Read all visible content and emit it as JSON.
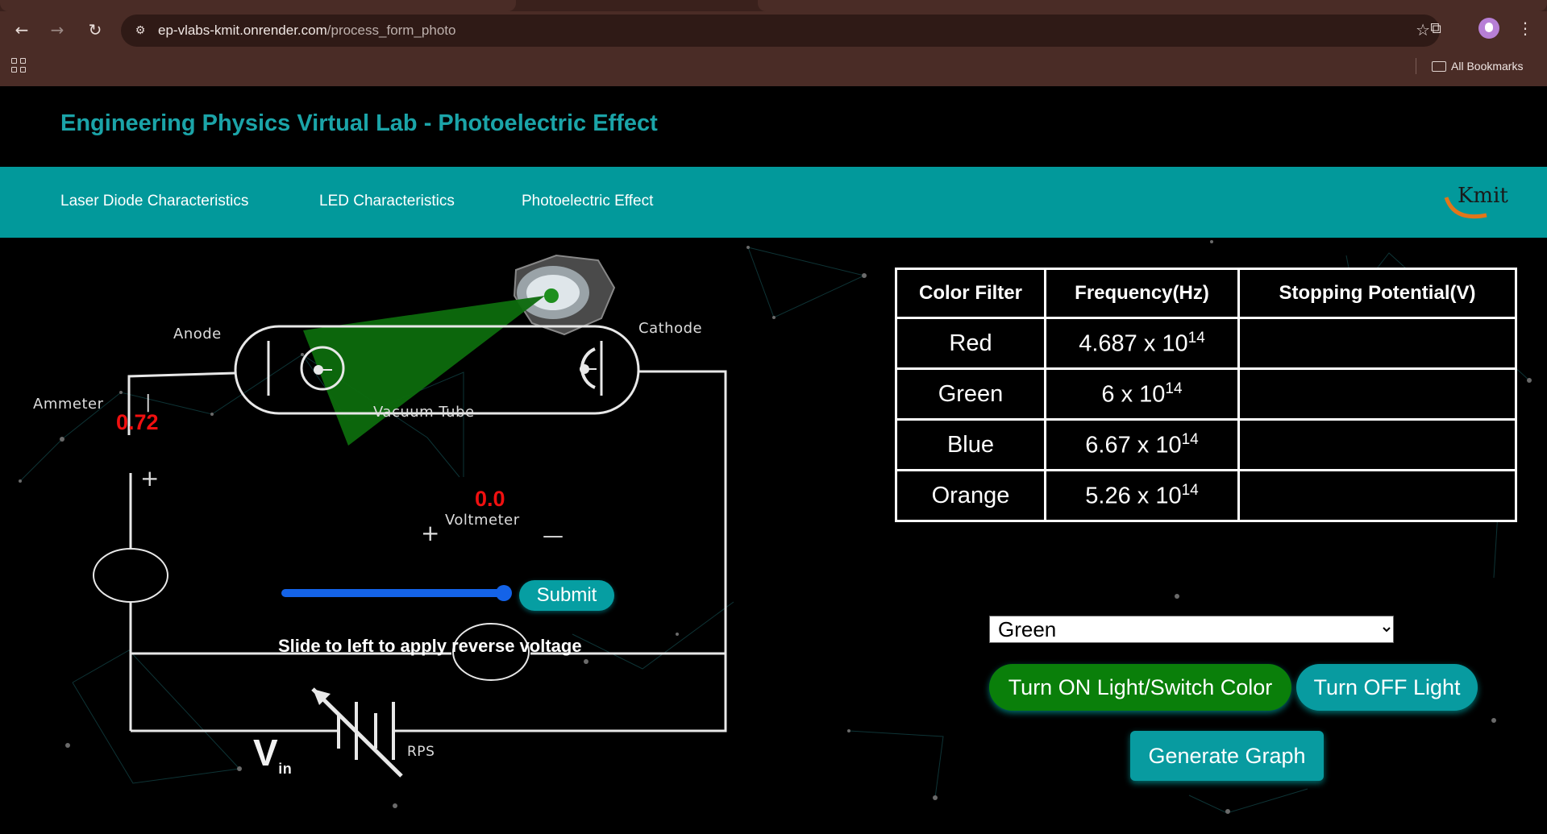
{
  "browser": {
    "url_host": "ep-vlabs-kmit.onrender.com",
    "url_path": "/process_form_photo",
    "bookmarks_label": "All Bookmarks"
  },
  "header": {
    "title": "Engineering Physics Virtual Lab - Photoelectric Effect"
  },
  "nav": {
    "items": [
      "Laser Diode Characteristics",
      "LED Characteristics",
      "Photoelectric Effect"
    ],
    "logo_text": "Kmit"
  },
  "circuit": {
    "anode_label": "Anode",
    "cathode_label": "Cathode",
    "ammeter_label": "Ammeter",
    "vacuum_tube_label": "Vacuum Tube",
    "voltmeter_label": "Voltmeter",
    "rps_label": "RPS",
    "vin_label": "V",
    "vin_sub": "in",
    "ammeter_reading": "0.72",
    "voltmeter_reading": "0.0",
    "plus_sign": "+",
    "minus_sign": "—",
    "ammeter_minus": "|"
  },
  "controls": {
    "slider_instruction": "Slide to left to apply reverse voltage",
    "slider_value_fraction": 1.0,
    "submit_label": "Submit",
    "selected_color": "Green",
    "turn_on_label": "Turn ON Light/Switch Color",
    "turn_off_label": "Turn OFF Light",
    "generate_graph_label": "Generate Graph"
  },
  "table": {
    "headers": [
      "Color Filter",
      "Frequency(Hz)",
      "Stopping Potential(V)"
    ],
    "rows": [
      {
        "color": "Red",
        "freq_mantissa": "4.687 x 10",
        "freq_exp": "14",
        "stopping": ""
      },
      {
        "color": "Green",
        "freq_mantissa": "6 x 10",
        "freq_exp": "14",
        "stopping": ""
      },
      {
        "color": "Blue",
        "freq_mantissa": "6.67 x 10",
        "freq_exp": "14",
        "stopping": ""
      },
      {
        "color": "Orange",
        "freq_mantissa": "5.26 x 10",
        "freq_exp": "14",
        "stopping": ""
      }
    ]
  },
  "colors": {
    "accent_teal": "#02999b",
    "title_teal": "#1ba4a8",
    "light_beam": "#0d6b0d",
    "reading_red": "#f01010",
    "on_button_green": "#0a7f0a"
  }
}
